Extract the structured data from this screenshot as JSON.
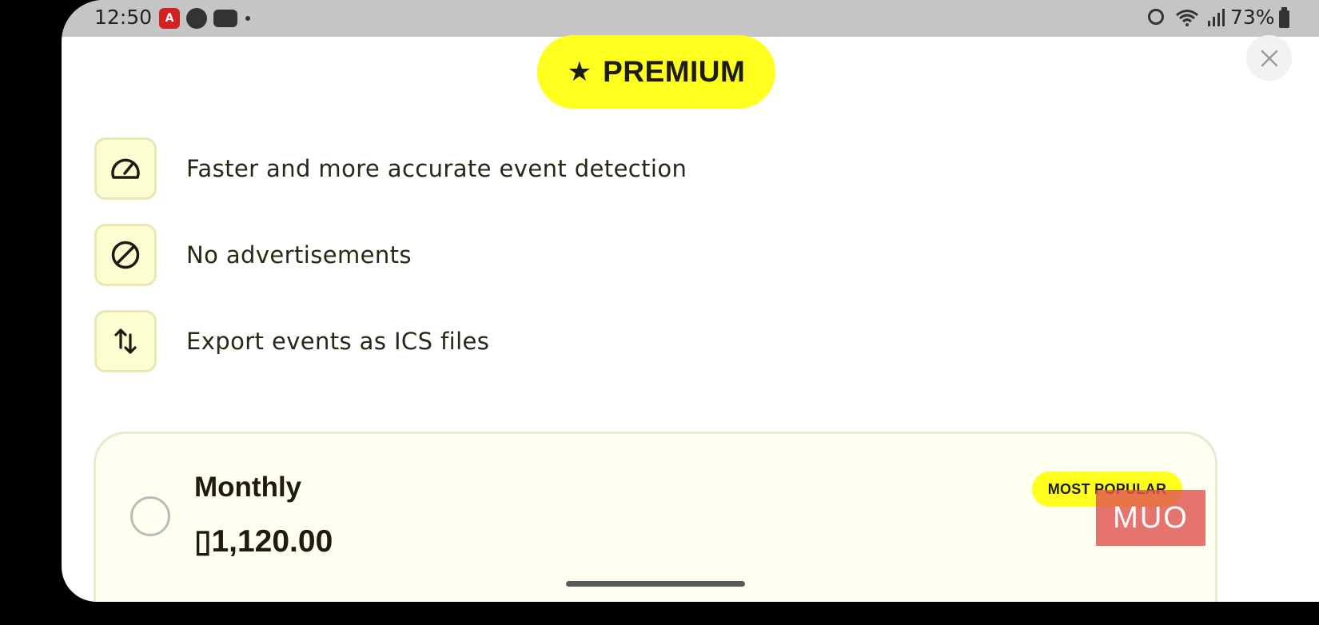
{
  "status_bar": {
    "time": "12:50",
    "app_icons": [
      "usa-app-icon",
      "chat-app-icon",
      "youtube-icon"
    ],
    "battery_percent": "73%"
  },
  "header": {
    "badge_label": "PREMIUM",
    "star_icon": "star-icon",
    "close_icon": "close-icon"
  },
  "features": [
    {
      "icon": "speedometer-icon",
      "text": "Faster and more accurate event detection"
    },
    {
      "icon": "block-icon",
      "text": "No advertisements"
    },
    {
      "icon": "swap-vertical-icon",
      "text": "Export events as ICS files"
    }
  ],
  "plans": [
    {
      "name": "Monthly",
      "price": "▯1,120.00",
      "badge": "MOST POPULAR",
      "selected": false
    }
  ],
  "watermark": "MUO",
  "colors": {
    "accent": "#ffff1f",
    "feature_bg": "#fdfdd2",
    "text": "#2a2616"
  }
}
